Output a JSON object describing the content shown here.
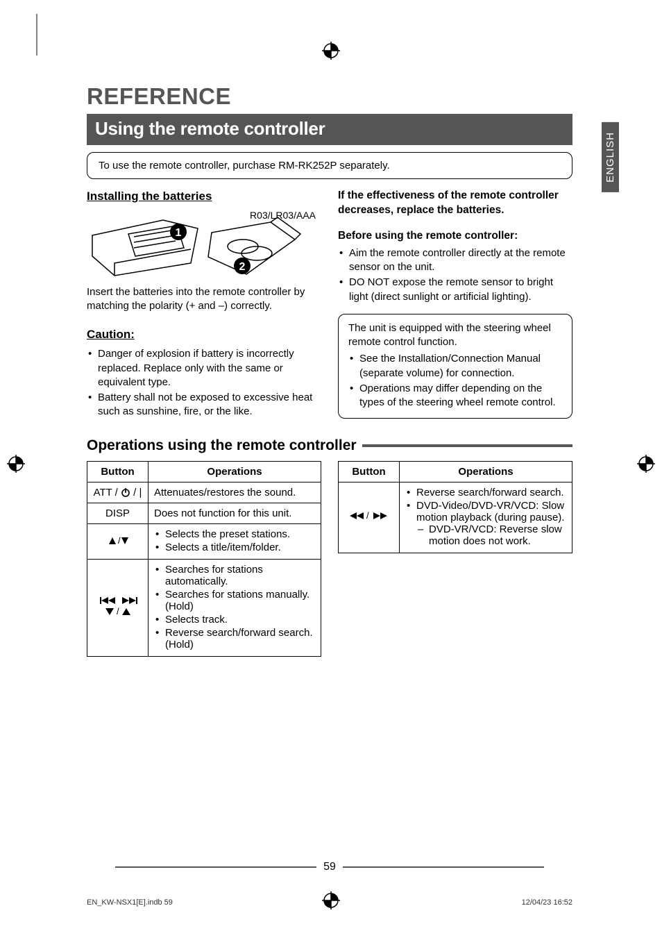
{
  "lang_tab": "ENGLISH",
  "h1": "REFERENCE",
  "section_title": "Using the remote controller",
  "notice": "To use the remote controller, purchase RM-RK252P separately.",
  "left": {
    "install_heading": "Installing the batteries",
    "battery_type": "R03/LR03/AAA",
    "insert_text": "Insert the batteries into the remote controller by matching the polarity (+ and –) correctly.",
    "caution_heading": "Caution:",
    "caution_items": [
      "Danger of explosion if battery is incorrectly replaced. Replace only with the same or equivalent type.",
      "Battery shall not be exposed to excessive heat such as sunshine, fire, or the like."
    ]
  },
  "right": {
    "effectiveness": "If the effectiveness of the remote controller decreases, replace the batteries.",
    "before_heading": "Before using the remote controller:",
    "before_items": [
      "Aim the remote controller directly at the remote sensor on the unit.",
      "DO NOT expose the remote sensor to bright light (direct sunlight or artificial lighting)."
    ],
    "note_intro": "The unit is equipped with the steering wheel remote control function.",
    "note_items": [
      "See the Installation/Connection Manual (separate volume) for connection.",
      "Operations may differ depending on the types of the steering wheel remote control."
    ]
  },
  "ops_heading": "Operations using the remote controller",
  "table_headers": {
    "button": "Button",
    "operations": "Operations"
  },
  "table1": [
    {
      "button_text": "ATT / ",
      "button_icon": "power",
      "button_suffix": " / |",
      "ops_text": "Attenuates/restores the sound."
    },
    {
      "button_text": "DISP",
      "ops_text": "Does not function for this unit."
    },
    {
      "button_icon": "up-down",
      "ops_list": [
        "Selects the preset stations.",
        "Selects a title/item/folder."
      ]
    },
    {
      "button_icon": "skip",
      "ops_list": [
        "Searches for stations automatically.",
        "Searches for stations manually. (Hold)",
        "Selects track.",
        "Reverse search/forward search. (Hold)"
      ]
    }
  ],
  "table2": [
    {
      "button_icon": "rew-ff",
      "ops_list": [
        "Reverse search/forward search.",
        "DVD-Video/DVD-VR/VCD: Slow motion playback (during pause)."
      ],
      "ops_sub": [
        "DVD-VR/VCD: Reverse slow motion does not work."
      ]
    }
  ],
  "page_number": "59",
  "footer_left": "EN_KW-NSX1[E].indb   59",
  "footer_right": "12/04/23   16:52"
}
